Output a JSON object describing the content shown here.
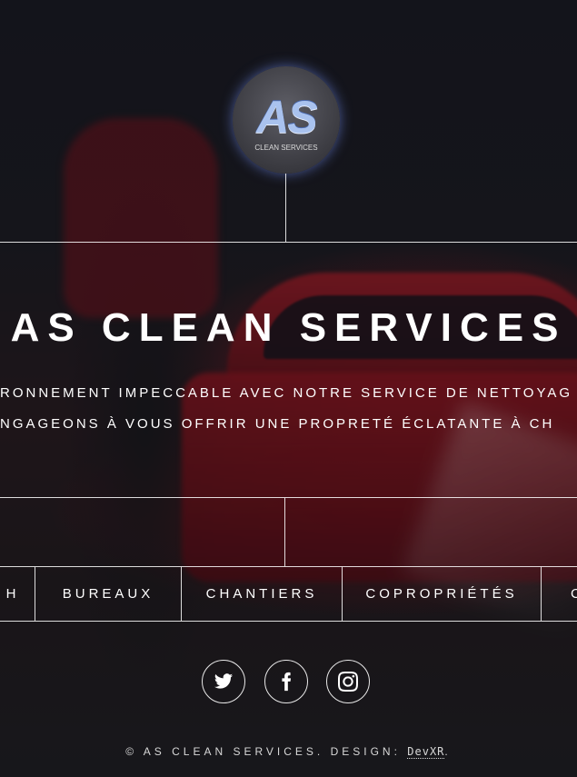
{
  "logo": {
    "mark": "AS",
    "subtitle": "CLEAN SERVICES"
  },
  "header": {
    "title": "AS CLEAN SERVICES",
    "tagline_line1": "RONNEMENT IMPECCABLE AVEC NOTRE SERVICE DE NETTOYAG",
    "tagline_line2": "NGAGEONS À VOUS OFFRIR UNE PROPRETÉ ÉCLATANTE À CH"
  },
  "nav": {
    "items": [
      {
        "label": "H"
      },
      {
        "label": "BUREAUX"
      },
      {
        "label": "CHANTIERS"
      },
      {
        "label": "COPROPRIÉTÉS"
      },
      {
        "label": "C"
      }
    ]
  },
  "social": {
    "icons": [
      "twitter-icon",
      "facebook-icon",
      "instagram-icon"
    ]
  },
  "footer": {
    "copyright": "© AS CLEAN SERVICES. DESIGN: ",
    "design_link": "DevXR",
    "suffix": "."
  }
}
